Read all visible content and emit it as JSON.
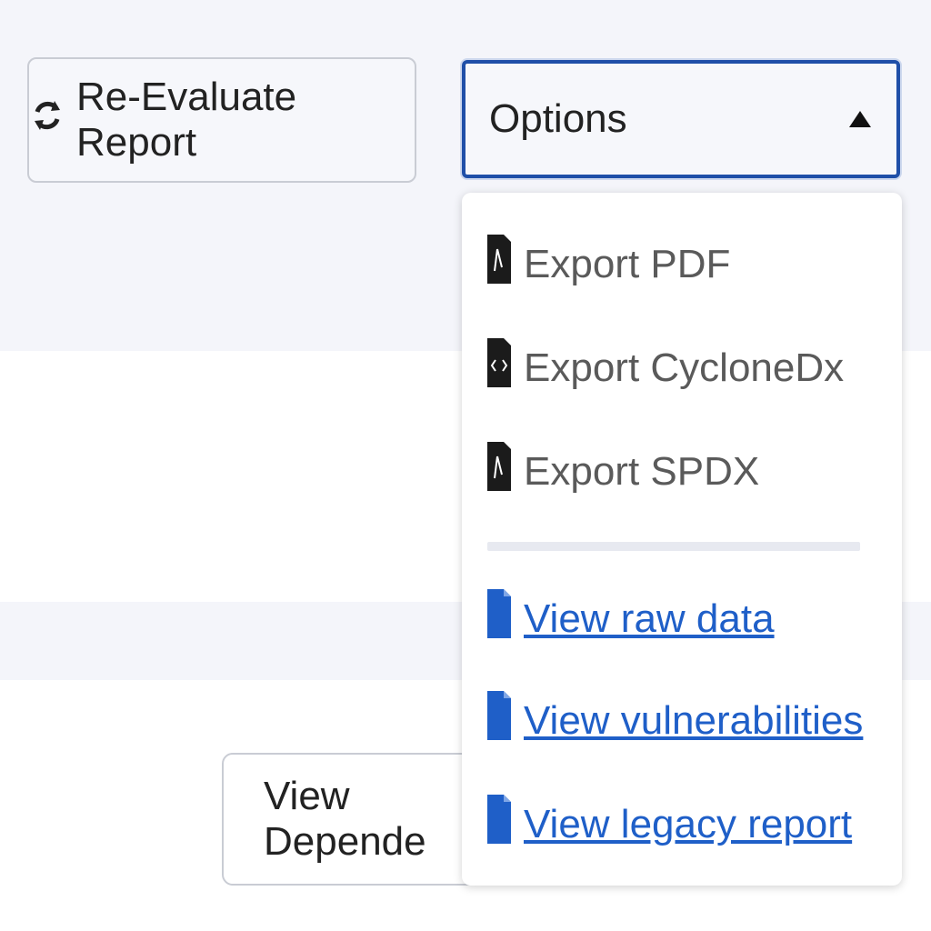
{
  "toolbar": {
    "reevaluate_label": "Re-Evaluate Report",
    "options_value": "Options"
  },
  "options_menu": {
    "export_items": [
      {
        "label": "Export PDF",
        "icon": "pdf-file-icon"
      },
      {
        "label": "Export CycloneDx",
        "icon": "code-file-icon"
      },
      {
        "label": "Export SPDX",
        "icon": "pdf-file-icon"
      }
    ],
    "link_items": [
      {
        "label": "View raw data",
        "icon": "file-icon"
      },
      {
        "label": "View vulnerabilities",
        "icon": "file-icon"
      },
      {
        "label": "View legacy report",
        "icon": "file-icon"
      }
    ]
  },
  "background_buttons": {
    "view_dependencies_label": "View Depende"
  },
  "colors": {
    "accent_blue": "#1f4fa8",
    "link_blue": "#1f5fc8",
    "page_bg": "#f4f5fa"
  }
}
